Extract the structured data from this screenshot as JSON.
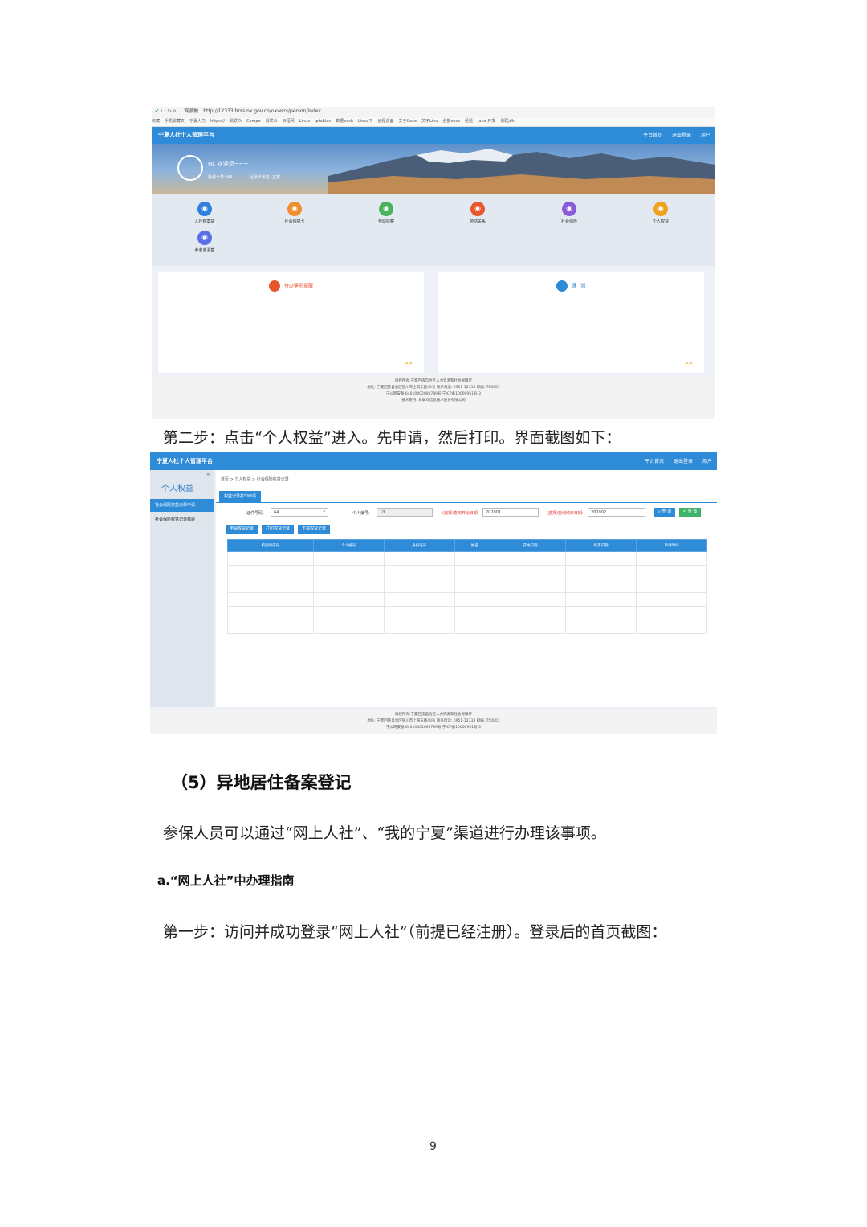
{
  "screenshot1": {
    "browser": {
      "url": "http://12333.hrss.nx.gov.cn/nxwsrs/person/index",
      "tab_label": "驾驶舱"
    },
    "bookmarks": [
      "收藏",
      "手机收藏夹",
      "宁夏人力",
      "https://",
      "易联众",
      "Compo",
      "易联众",
      "日程网",
      "Linux",
      "iptables",
      "数据bash",
      "Linux下",
      "远程桌面",
      "关于Coco",
      "关于Linu",
      "全部coco",
      "经验",
      "Java 开发",
      "易联jdk"
    ],
    "app_title": "宁夏人社个人管理平台",
    "header_links": {
      "home": "平台首页",
      "logout": "退出登录",
      "user": "用户"
    },
    "greeting": "Hi, 欢迎您~~~",
    "ssn_label": "社保卡号: N4",
    "ssn_status": "社保卡状态: 正常",
    "services": [
      {
        "label": "人社档案袋",
        "icon": "archive-icon",
        "color": "#2f7fe0"
      },
      {
        "label": "社会保障卡",
        "icon": "card-icon",
        "color": "#f08b2e"
      },
      {
        "label": "劳动监察",
        "icon": "inspect-icon",
        "color": "#49b35a"
      },
      {
        "label": "劳动关系",
        "icon": "relation-icon",
        "color": "#e8572b"
      },
      {
        "label": "社会保险",
        "icon": "insurance-icon",
        "color": "#8a5bd6"
      },
      {
        "label": "个人权益",
        "icon": "rights-icon",
        "color": "#f0a21f"
      },
      {
        "label": "养老金测算",
        "icon": "pension-icon",
        "color": "#5b6ee6"
      }
    ],
    "todo_title": "待办事项提醒",
    "notice_title": "通　知",
    "more": ">>",
    "footer": [
      "版权所有:宁夏回族自治区人力资源和社会保障厅",
      "地址: 宁夏回族自治区银川市上海东路40号 联系电话: 0951-12333 邮编: 750001",
      "宁公网安备 64010402000789号 宁ICP备10000951号-3",
      "技术支持: 易联众信息技术股份有限公司"
    ]
  },
  "step2_text": "第二步：点击“个人权益”进入。先申请，然后打印。界面截图如下：",
  "screenshot2": {
    "app_title": "宁夏人社个人管理平台",
    "header_links": {
      "home": "平台首页",
      "logout": "退出登录",
      "user": "用户"
    },
    "sidebar_title": "个人权益",
    "sidebar_items": [
      "社会保险权益记录申请",
      "社会保险权益记录核验"
    ],
    "breadcrumb": "首页 > 个人权益 > 社会保险权益记录",
    "tab": "权益记录打印申请",
    "form": {
      "id_label": "证件号码:",
      "id_value": "64",
      "id_suffix": "2",
      "person_label": "个人编号:",
      "person_value": "10",
      "start_label": "(选择)查询开始日期:",
      "start_value": "202001",
      "end_label": "(选择)查询结束日期:",
      "end_value": "202002",
      "query": "查 询",
      "reset": "重 置"
    },
    "actions": [
      "申请权益记录",
      "打印权益记录",
      "下载权益记录"
    ],
    "table_headers": [
      "校验码序号",
      "个人编号",
      "身份证号",
      "姓名",
      "开始日期",
      "结束日期",
      "申请时间"
    ],
    "footer": [
      "版权所有:宁夏回族自治区人力资源和社会保障厅",
      "地址: 宁夏回族自治区银川市上海东路40号 联系电话: 0951-12333 邮编: 750001",
      "宁公网安备 64010402000789号 宁ICP备10000951号-3"
    ]
  },
  "section_heading": "（5）异地居住备案登记",
  "section_para": "参保人员可以通过“网上人社”、“我的宁夏”渠道进行办理该事项。",
  "sub_heading": "a.“网上人社”中办理指南",
  "step1_text": "第一步：访问并成功登录“网上人社”（前提已经注册）。登录后的首页截图：",
  "page_number": "9"
}
